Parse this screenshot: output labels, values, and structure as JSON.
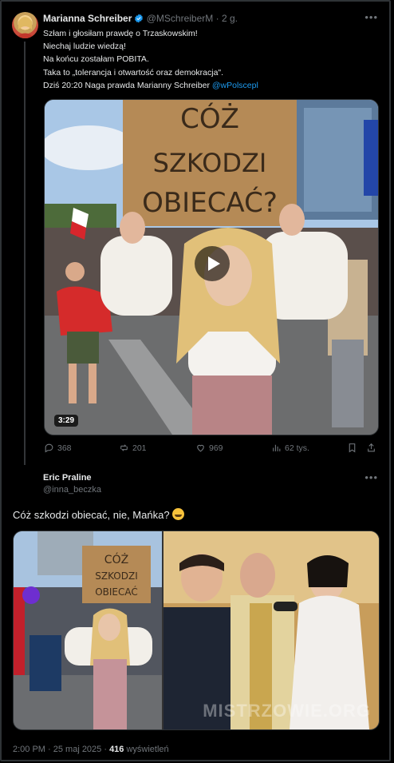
{
  "tweet1": {
    "author_name": "Marianna Schreiber",
    "author_handle": "@MSchreiberM",
    "separator": "·",
    "age": "2 g.",
    "lines": [
      "Szłam i głosiłam prawdę o Trzaskowskim!",
      "Niechaj ludzie wiedzą!",
      "Na końcu zostałam POBITA.",
      "Taka to „tolerancja i otwartość oraz demokracja\".",
      "Dziś 20:20 Naga prawda Marianny Schreiber "
    ],
    "mention": "@wPolscepl",
    "video_sign_text": "CÓŻ SZKODZI OBIECAĆ?",
    "video_duration": "3:29",
    "stats": {
      "replies": "368",
      "reposts": "201",
      "likes": "969",
      "views": "62 tys."
    },
    "icons": [
      "reply-icon",
      "repost-icon",
      "like-icon",
      "views-icon",
      "bookmark-icon",
      "share-icon",
      "more-icon",
      "verified-badge-icon",
      "play-icon"
    ]
  },
  "tweet2": {
    "author_name": "Eric Praline",
    "author_handle": "@inna_beczka",
    "text": "Cóż szkodzi obiecać, nie, Mańka? ",
    "emoji": "rolling-on-floor-laughing",
    "image_sign_text": "CÓŻ SZKODZI OBIECAĆ",
    "watermark": "MISTRZOWIE.ORG",
    "footer_time": "2:00 PM · 25 maj 2025 · ",
    "footer_views": "416",
    "footer_views_label": " wyświetleń"
  },
  "colors": {
    "background": "#000000",
    "text": "#e7e9ea",
    "muted": "#71767b",
    "link": "#1d9bf0",
    "border": "#2f3336"
  }
}
